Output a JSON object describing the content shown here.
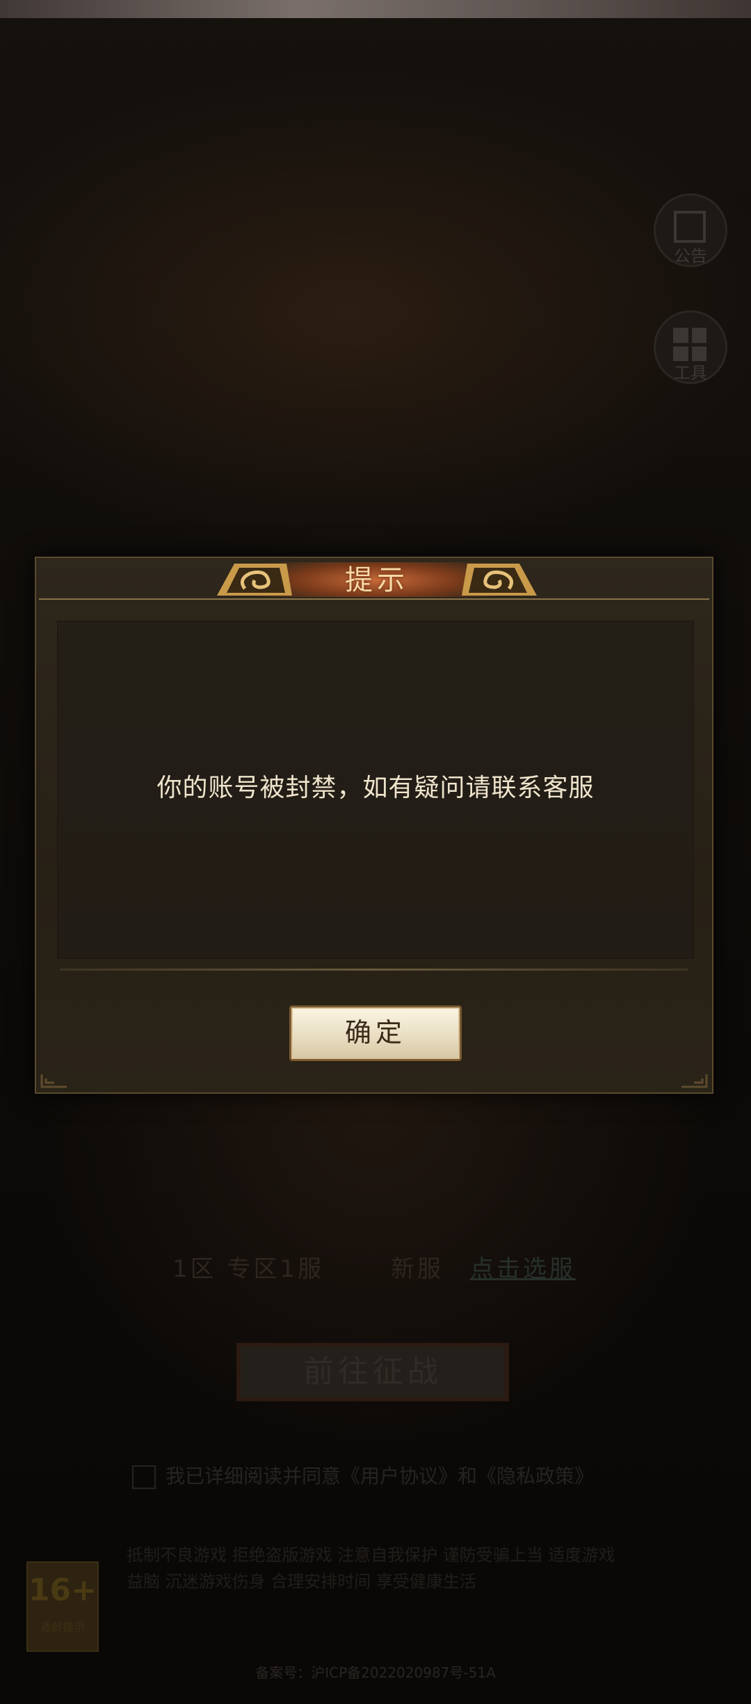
{
  "background": {
    "side_buttons": [
      {
        "label": "公告",
        "icon": "notice-board-icon"
      },
      {
        "label": "工具",
        "icon": "grid-menu-icon"
      }
    ],
    "server": {
      "zone": "1区 专区1服",
      "status": "新服",
      "select_label": "点击选服"
    },
    "enter_button": "前往征战",
    "agreement": "我已详细阅读并同意《用户协议》和《隐私政策》",
    "age_rating": {
      "number": "16+",
      "caption": "适龄提示"
    },
    "legal_text": "抵制不良游戏 拒绝盗版游戏 注意自我保护 谨防受骗上当 适度游戏益脑 沉迷游戏伤身 合理安排时间 享受健康生活",
    "icp": "备案号：沪ICP备2022020987号-51A"
  },
  "dialog": {
    "title": "提示",
    "message": "你的账号被封禁，如有疑问请联系客服",
    "confirm_label": "确定"
  }
}
